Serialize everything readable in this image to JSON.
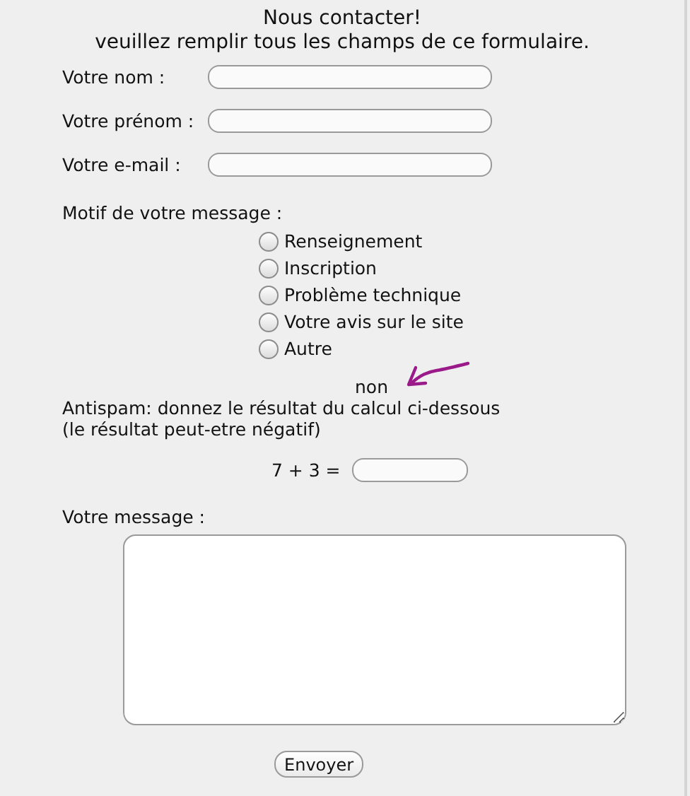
{
  "heading": {
    "title": "Nous contacter!",
    "subtitle": "veuillez remplir tous les champs de ce formulaire."
  },
  "fields": [
    {
      "label": "Votre nom :"
    },
    {
      "label": "Votre prénom :"
    },
    {
      "label": "Votre e-mail :"
    }
  ],
  "reason": {
    "label": "Motif de votre message :",
    "options": [
      {
        "label": "Renseignement",
        "selected": false
      },
      {
        "label": "Inscription",
        "selected": false
      },
      {
        "label": "Problème technique",
        "selected": false
      },
      {
        "label": "Votre avis sur le site",
        "selected": false
      },
      {
        "label": "Autre",
        "selected": false
      }
    ]
  },
  "annotation": {
    "text": "non",
    "color": "#9b1a8a"
  },
  "antispam": {
    "lines": [
      "Antispam: donnez le résultat du calcul ci-dessous",
      "(le résultat peut-etre négatif)"
    ],
    "equation": "7 + 3 ="
  },
  "message": {
    "label": "Votre message :"
  },
  "submit": "Envoyer"
}
